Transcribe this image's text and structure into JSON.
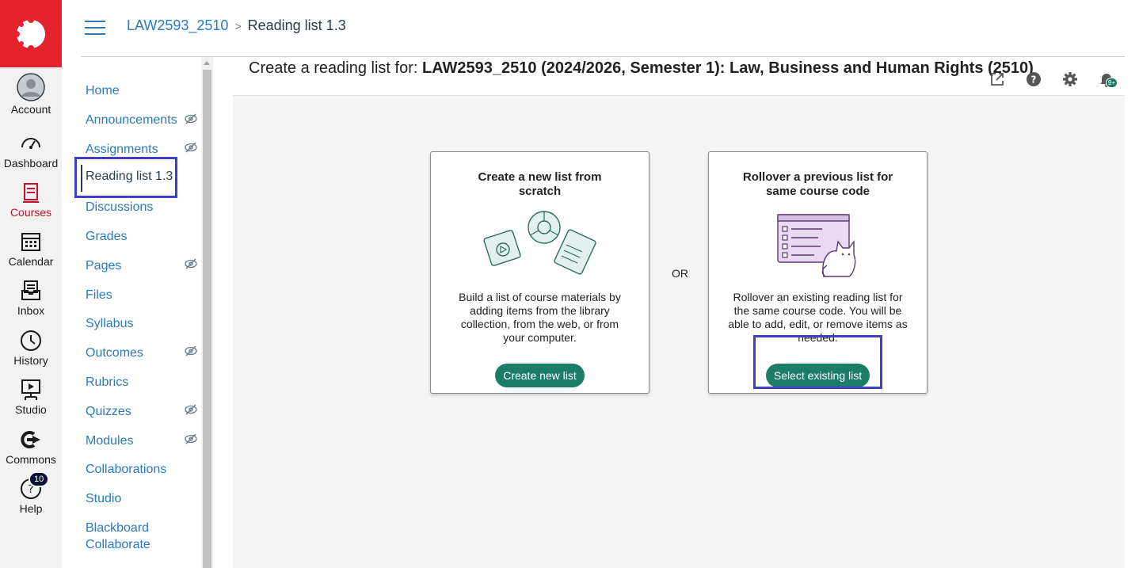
{
  "global_nav": {
    "items": [
      {
        "label": "Account",
        "icon": "account-icon"
      },
      {
        "label": "Dashboard",
        "icon": "dashboard-icon"
      },
      {
        "label": "Courses",
        "icon": "courses-icon",
        "active": true
      },
      {
        "label": "Calendar",
        "icon": "calendar-icon"
      },
      {
        "label": "Inbox",
        "icon": "inbox-icon"
      },
      {
        "label": "History",
        "icon": "history-icon"
      },
      {
        "label": "Studio",
        "icon": "studio-icon"
      },
      {
        "label": "Commons",
        "icon": "commons-icon"
      },
      {
        "label": "Help",
        "icon": "help-icon",
        "badge": "10"
      }
    ]
  },
  "breadcrumb": {
    "course": "LAW2593_2510",
    "separator": ">",
    "current": "Reading list 1.3"
  },
  "course_nav": {
    "items": [
      {
        "label": "Home"
      },
      {
        "label": "Announcements",
        "hidden": true
      },
      {
        "label": "Assignments",
        "hidden": true
      },
      {
        "label": "Reading list 1.3",
        "active": true
      },
      {
        "label": "Discussions"
      },
      {
        "label": "Grades"
      },
      {
        "label": "Pages",
        "hidden": true
      },
      {
        "label": "Files"
      },
      {
        "label": "Syllabus"
      },
      {
        "label": "Outcomes",
        "hidden": true
      },
      {
        "label": "Rubrics"
      },
      {
        "label": "Quizzes",
        "hidden": true
      },
      {
        "label": "Modules",
        "hidden": true
      },
      {
        "label": "Collaborations"
      },
      {
        "label": "Studio"
      },
      {
        "label": "Blackboard Collaborate"
      }
    ]
  },
  "main": {
    "title_prefix": "Create a reading list for: ",
    "title_bold": "LAW2593_2510 (2024/2026, Semester 1): Law, Business and Human Rights (2510)",
    "header_icons": [
      "external-link-icon",
      "help-circle-icon",
      "gear-icon",
      "notification-bell-icon"
    ],
    "notification_badge": "9+",
    "or_label": "OR",
    "cards": [
      {
        "heading": "Create a new list from scratch",
        "description": "Build a list of course materials by adding items from the library collection, from the web, or from your computer.",
        "button": "Create new list"
      },
      {
        "heading": "Rollover a previous list for same course code",
        "description": "Rollover an existing reading list for the same course code. You will be able to add, edit, or remove items as needed.",
        "button": "Select existing list"
      }
    ]
  },
  "colors": {
    "brand_red": "#e4232e",
    "link_blue": "#2b7abc",
    "button_green": "#1b7d66",
    "highlight_box": "#3f3fbf"
  }
}
